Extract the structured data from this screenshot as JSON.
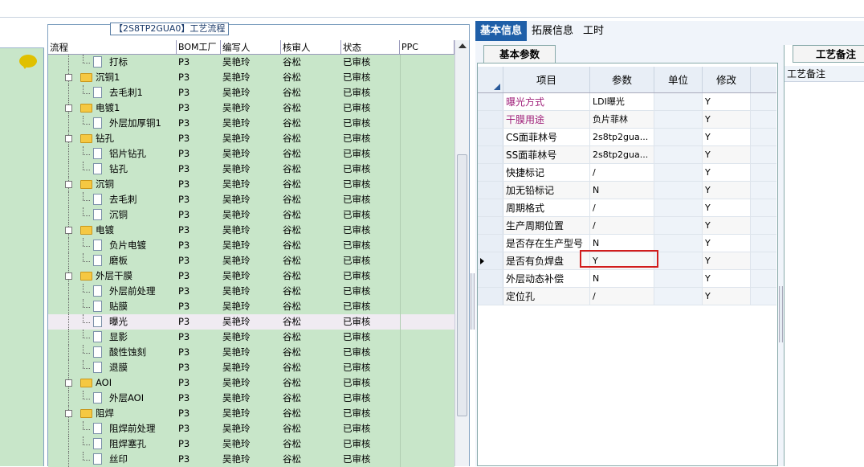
{
  "flow_title": "【2S8TP2GUA0】工艺流程",
  "columns": [
    "流程",
    "BOM工厂",
    "编写人",
    "核审人",
    "状态",
    "PPC"
  ],
  "rows": [
    {
      "name": "打标",
      "level": 2,
      "folder": false,
      "bom": "P3",
      "writer": "吴艳玲",
      "reviewer": "谷松",
      "status": "已审核"
    },
    {
      "name": "沉铜1",
      "level": 1,
      "folder": true,
      "bom": "P3",
      "writer": "吴艳玲",
      "reviewer": "谷松",
      "status": "已审核"
    },
    {
      "name": "去毛刺1",
      "level": 2,
      "folder": false,
      "bom": "P3",
      "writer": "吴艳玲",
      "reviewer": "谷松",
      "status": "已审核"
    },
    {
      "name": "电镀1",
      "level": 1,
      "folder": true,
      "bom": "P3",
      "writer": "吴艳玲",
      "reviewer": "谷松",
      "status": "已审核"
    },
    {
      "name": "外层加厚铜1",
      "level": 2,
      "folder": false,
      "bom": "P3",
      "writer": "吴艳玲",
      "reviewer": "谷松",
      "status": "已审核"
    },
    {
      "name": "钻孔",
      "level": 1,
      "folder": true,
      "bom": "P3",
      "writer": "吴艳玲",
      "reviewer": "谷松",
      "status": "已审核"
    },
    {
      "name": "铝片钻孔",
      "level": 2,
      "folder": false,
      "bom": "P3",
      "writer": "吴艳玲",
      "reviewer": "谷松",
      "status": "已审核"
    },
    {
      "name": "钻孔",
      "level": 2,
      "folder": false,
      "bom": "P3",
      "writer": "吴艳玲",
      "reviewer": "谷松",
      "status": "已审核"
    },
    {
      "name": "沉铜",
      "level": 1,
      "folder": true,
      "bom": "P3",
      "writer": "吴艳玲",
      "reviewer": "谷松",
      "status": "已审核"
    },
    {
      "name": "去毛刺",
      "level": 2,
      "folder": false,
      "bom": "P3",
      "writer": "吴艳玲",
      "reviewer": "谷松",
      "status": "已审核"
    },
    {
      "name": "沉铜",
      "level": 2,
      "folder": false,
      "bom": "P3",
      "writer": "吴艳玲",
      "reviewer": "谷松",
      "status": "已审核"
    },
    {
      "name": "电镀",
      "level": 1,
      "folder": true,
      "bom": "P3",
      "writer": "吴艳玲",
      "reviewer": "谷松",
      "status": "已审核"
    },
    {
      "name": "负片电镀",
      "level": 2,
      "folder": false,
      "bom": "P3",
      "writer": "吴艳玲",
      "reviewer": "谷松",
      "status": "已审核"
    },
    {
      "name": "磨板",
      "level": 2,
      "folder": false,
      "bom": "P3",
      "writer": "吴艳玲",
      "reviewer": "谷松",
      "status": "已审核"
    },
    {
      "name": "外层干膜",
      "level": 1,
      "folder": true,
      "bom": "P3",
      "writer": "吴艳玲",
      "reviewer": "谷松",
      "status": "已审核"
    },
    {
      "name": "外层前处理",
      "level": 2,
      "folder": false,
      "bom": "P3",
      "writer": "吴艳玲",
      "reviewer": "谷松",
      "status": "已审核"
    },
    {
      "name": "贴膜",
      "level": 2,
      "folder": false,
      "bom": "P3",
      "writer": "吴艳玲",
      "reviewer": "谷松",
      "status": "已审核"
    },
    {
      "name": "曝光",
      "level": 2,
      "folder": false,
      "bom": "P3",
      "writer": "吴艳玲",
      "reviewer": "谷松",
      "status": "已审核",
      "selected": true
    },
    {
      "name": "显影",
      "level": 2,
      "folder": false,
      "bom": "P3",
      "writer": "吴艳玲",
      "reviewer": "谷松",
      "status": "已审核"
    },
    {
      "name": "酸性蚀刻",
      "level": 2,
      "folder": false,
      "bom": "P3",
      "writer": "吴艳玲",
      "reviewer": "谷松",
      "status": "已审核"
    },
    {
      "name": "退膜",
      "level": 2,
      "folder": false,
      "bom": "P3",
      "writer": "吴艳玲",
      "reviewer": "谷松",
      "status": "已审核"
    },
    {
      "name": "AOI",
      "level": 1,
      "folder": true,
      "bom": "P3",
      "writer": "吴艳玲",
      "reviewer": "谷松",
      "status": "已审核"
    },
    {
      "name": "外层AOI",
      "level": 2,
      "folder": false,
      "bom": "P3",
      "writer": "吴艳玲",
      "reviewer": "谷松",
      "status": "已审核"
    },
    {
      "name": "阻焊",
      "level": 1,
      "folder": true,
      "bom": "P3",
      "writer": "吴艳玲",
      "reviewer": "谷松",
      "status": "已审核"
    },
    {
      "name": "阻焊前处理",
      "level": 2,
      "folder": false,
      "bom": "P3",
      "writer": "吴艳玲",
      "reviewer": "谷松",
      "status": "已审核"
    },
    {
      "name": "阻焊塞孔",
      "level": 2,
      "folder": false,
      "bom": "P3",
      "writer": "吴艳玲",
      "reviewer": "谷松",
      "status": "已审核"
    },
    {
      "name": "丝印",
      "level": 2,
      "folder": false,
      "bom": "P3",
      "writer": "吴艳玲",
      "reviewer": "谷松",
      "status": "已审核"
    }
  ],
  "tabs": [
    "基本信息",
    "拓展信息",
    "工时"
  ],
  "active_tab": 0,
  "subtab": "基本参数",
  "param_columns": [
    "项目",
    "参数",
    "单位",
    "修改"
  ],
  "params": [
    {
      "item": "曝光方式",
      "value": "LDI曝光",
      "unit": "",
      "modify": "Y",
      "item_color": "#a0207a"
    },
    {
      "item": "干膜用途",
      "value": "负片菲林",
      "unit": "",
      "modify": "Y",
      "item_color": "#a0207a"
    },
    {
      "item": "CS面菲林号",
      "value": "2s8tp2gua...",
      "unit": "",
      "modify": "Y"
    },
    {
      "item": "SS面菲林号",
      "value": "2s8tp2gua...",
      "unit": "",
      "modify": "Y"
    },
    {
      "item": "快捷标记",
      "value": "/",
      "unit": "",
      "modify": "Y"
    },
    {
      "item": "加无铅标记",
      "value": "N",
      "unit": "",
      "modify": "Y"
    },
    {
      "item": "周期格式",
      "value": "/",
      "unit": "",
      "modify": "Y"
    },
    {
      "item": "生产周期位置",
      "value": "/",
      "unit": "",
      "modify": "Y"
    },
    {
      "item": "是否存在生产型号",
      "value": "N",
      "unit": "",
      "modify": "Y"
    },
    {
      "item": "是否有负焊盘",
      "value": "Y",
      "unit": "",
      "modify": "Y",
      "current": true
    },
    {
      "item": "外层动态补偿",
      "value": "N",
      "unit": "",
      "modify": "Y"
    },
    {
      "item": "定位孔",
      "value": "/",
      "unit": "",
      "modify": "Y"
    }
  ],
  "note_tab": "工艺备注",
  "note_header": "工艺备注",
  "colors": {
    "row_green": "#c8e6c9",
    "tab_active": "#1f5fa8",
    "highlight": "#d21c1c",
    "purple_text": "#a0207a"
  }
}
